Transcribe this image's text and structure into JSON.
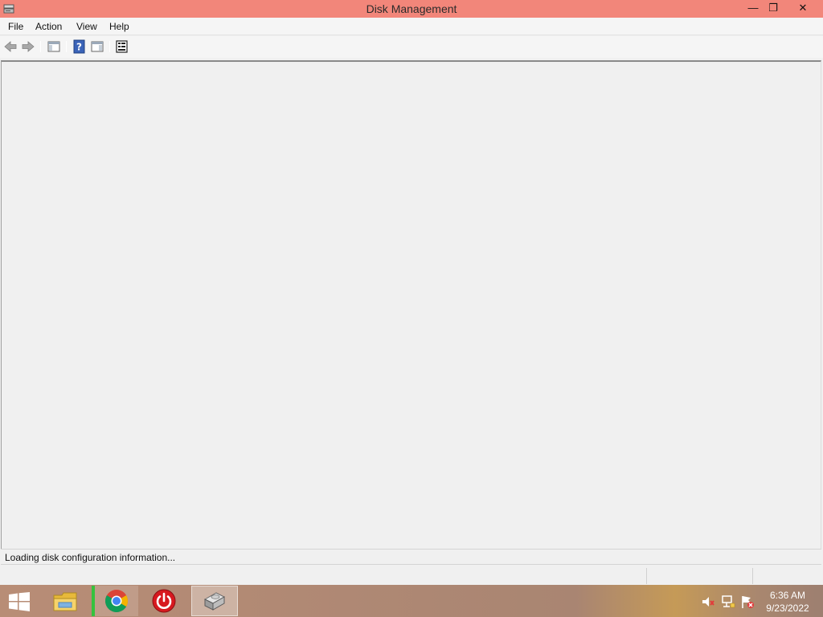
{
  "window": {
    "title": "Disk Management",
    "controls": {
      "minimize": "—",
      "maximize": "❐",
      "close": "✕"
    }
  },
  "menu": {
    "items": [
      "File",
      "Action",
      "View",
      "Help"
    ]
  },
  "toolbar": {
    "buttons": [
      "back-icon",
      "forward-icon",
      "show-hide-console-tree-icon",
      "help-icon",
      "show-hide-action-pane-icon",
      "properties-icon"
    ]
  },
  "status": {
    "message": "Loading disk configuration information..."
  },
  "taskbar": {
    "apps": [
      "file-explorer-icon",
      "chrome-icon",
      "power-app-icon",
      "disk-management-icon"
    ],
    "tray": [
      "volume-muted-icon",
      "network-icon",
      "action-center-icon"
    ],
    "clock": {
      "time": "6:36 AM",
      "date": "9/23/2022"
    }
  },
  "colors": {
    "titlebar": "#f2867a",
    "background": "#f0f0f0",
    "taskbar": "#a98572"
  }
}
